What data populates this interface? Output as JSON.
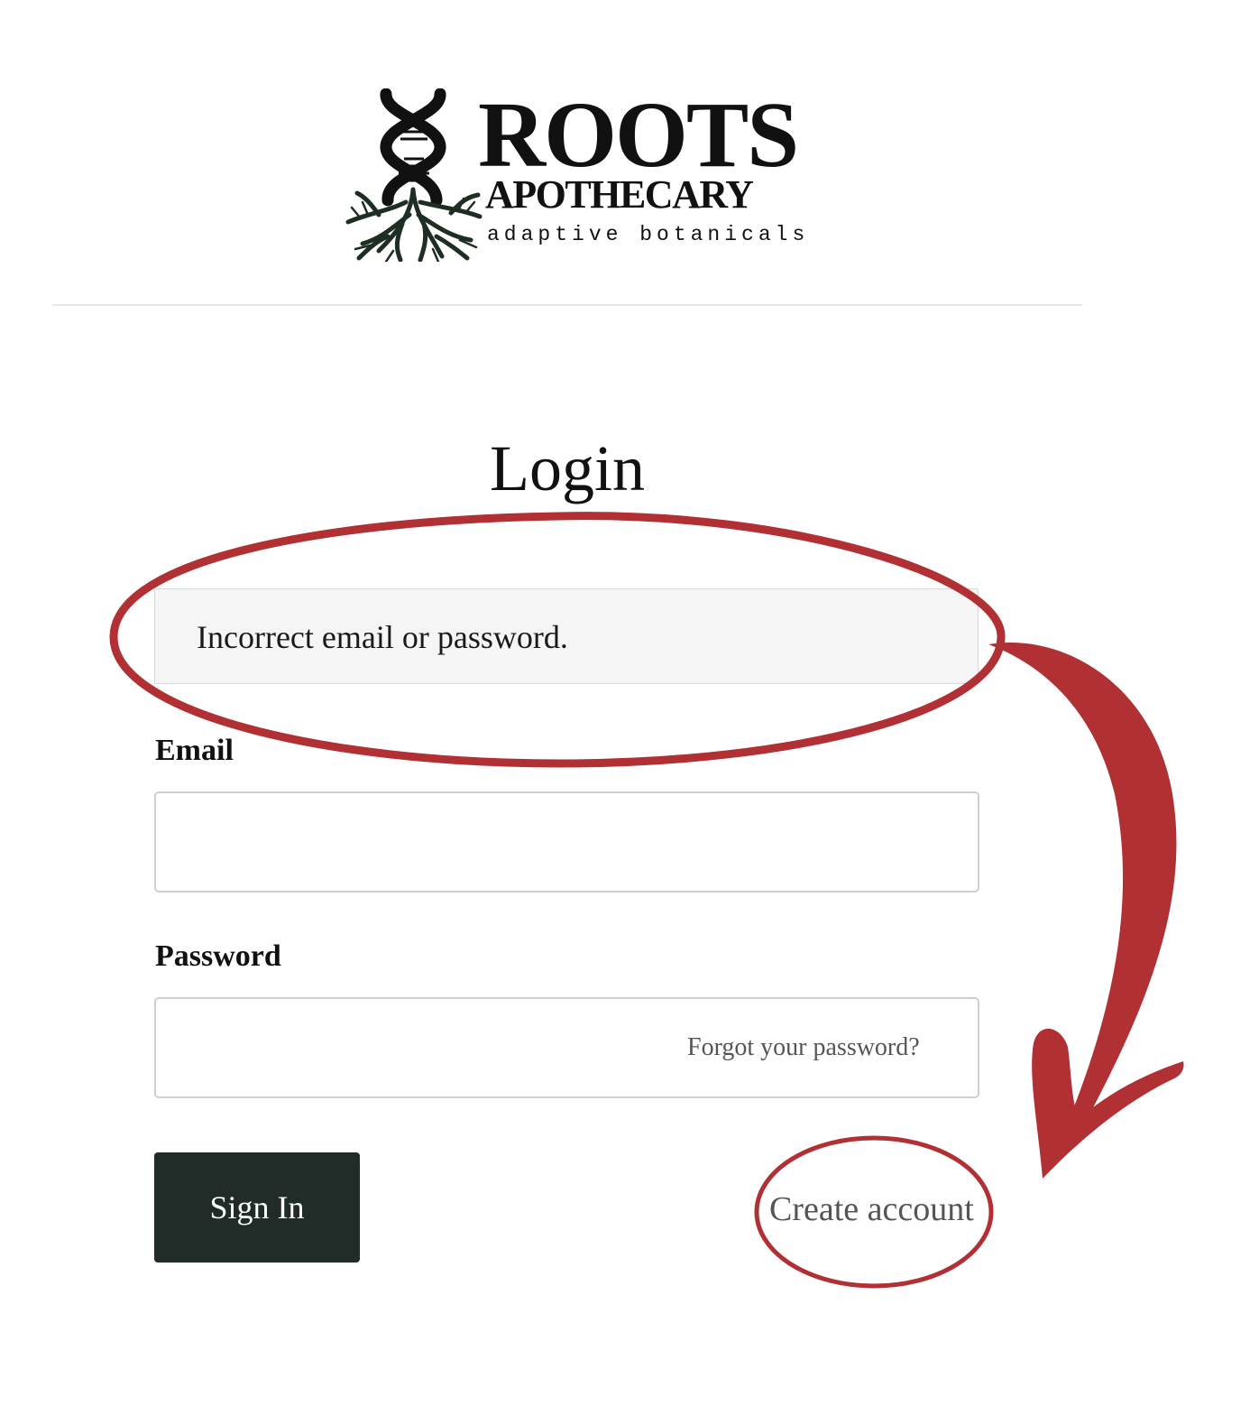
{
  "brand": {
    "name": "ROOTS",
    "subname": "APOTHECARY",
    "tagline": "adaptive botanicals",
    "logo_icon": "dna-roots-logo-icon"
  },
  "login": {
    "title": "Login",
    "error_message": "Incorrect email or password.",
    "email_label": "Email",
    "email_value": "",
    "password_label": "Password",
    "password_value": "",
    "forgot_password_label": "Forgot your password?",
    "sign_in_label": "Sign In",
    "create_account_label": "Create account"
  },
  "colors": {
    "button_bg": "#212b27",
    "annotation_red": "#b03034",
    "error_bg": "#f4f5f4"
  }
}
